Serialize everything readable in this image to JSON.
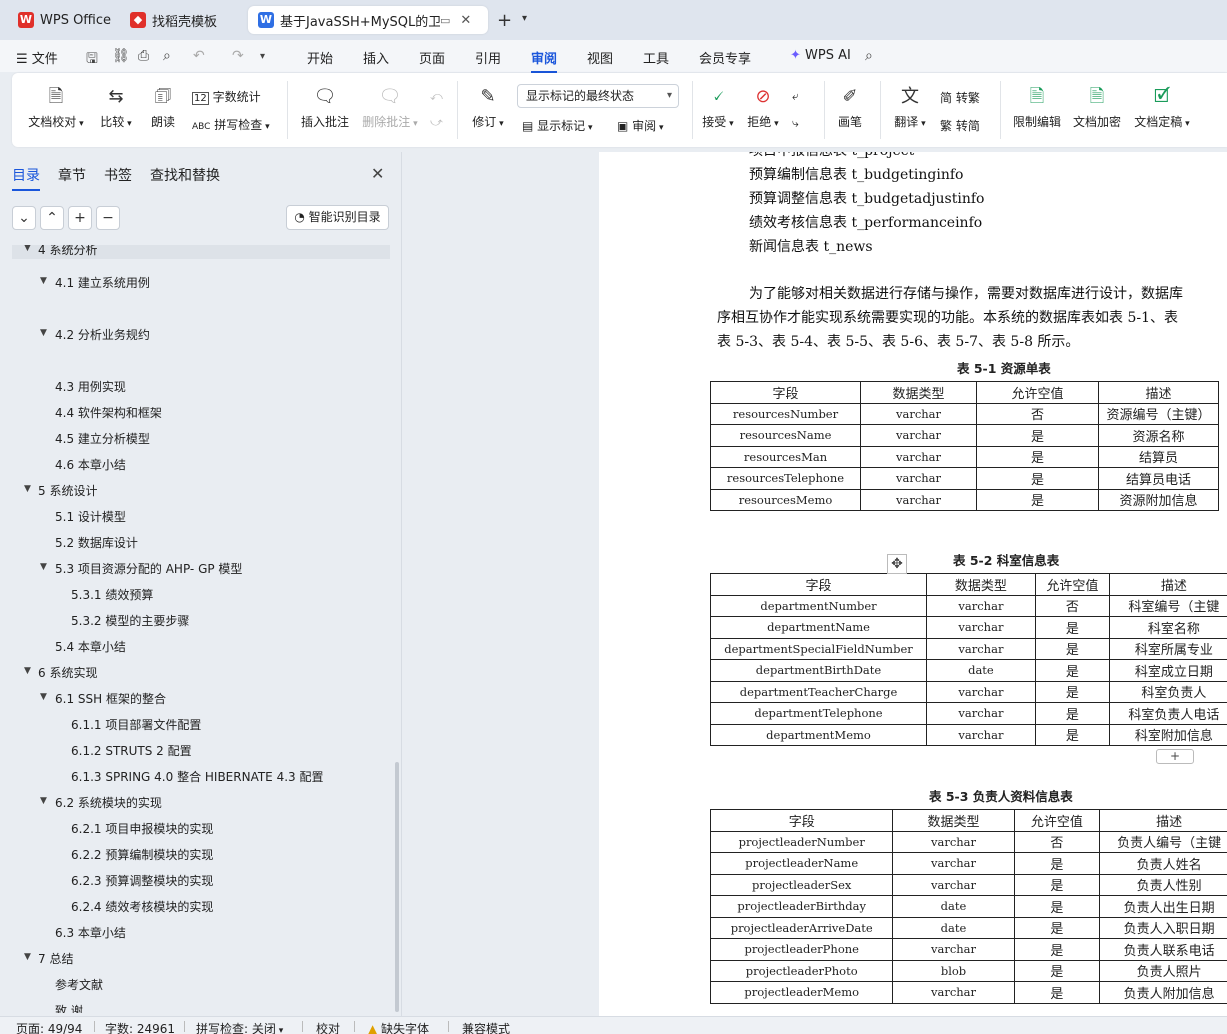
{
  "tabs": [
    {
      "label": "WPS Office",
      "logo": "wps-logo"
    },
    {
      "label": "找稻壳模板",
      "logo": "docer-logo"
    },
    {
      "label": "基于JavaSSH+MySQL的卫生",
      "logo": "writer-logo"
    }
  ],
  "menu": {
    "file": "文件",
    "items": [
      "开始",
      "插入",
      "页面",
      "引用",
      "审阅",
      "视图",
      "工具",
      "会员专享"
    ],
    "active": "审阅",
    "wps_ai": "WPS AI"
  },
  "ribbon": {
    "doc_proof": "文档校对",
    "compare": "比较",
    "read_aloud": "朗读",
    "word_count": "字数统计",
    "spell_check": "拼写检查",
    "insert_comment": "插入批注",
    "delete_comment": "删除批注",
    "track": "修订",
    "markup_state": "显示标记的最终状态",
    "show_markup": "显示标记",
    "review": "审阅",
    "accept": "接受",
    "reject": "拒绝",
    "ink": "画笔",
    "translate": "翻译",
    "simp_to_trad": "简 转繁",
    "trad_to_simp": "繁 转简",
    "restrict": "限制编辑",
    "encrypt": "文档加密",
    "finalize": "文档定稿"
  },
  "nav": {
    "tabs": [
      "目录",
      "章节",
      "书签",
      "查找和替换"
    ],
    "smart_toc": "智能识别目录",
    "toc": [
      {
        "label": "4  系统分析",
        "level": 1,
        "arrow": true
      },
      {
        "label": "4.1  建立系统用例",
        "level": 2,
        "arrow": true
      },
      {
        "label": "4.2  分析业务规约",
        "level": 2,
        "arrow": true
      },
      {
        "label": "4.3  用例实现",
        "level": 2,
        "arrow": false
      },
      {
        "label": "4.4  软件架构和框架",
        "level": 2,
        "arrow": false
      },
      {
        "label": "4.5  建立分析模型",
        "level": 2,
        "arrow": false
      },
      {
        "label": "4.6  本章小结",
        "level": 2,
        "arrow": false
      },
      {
        "label": "5  系统设计",
        "level": 1,
        "arrow": true
      },
      {
        "label": "5.1  设计模型",
        "level": 2,
        "arrow": false
      },
      {
        "label": "5.2  数据库设计",
        "level": 2,
        "arrow": false
      },
      {
        "label": "5.3  项目资源分配的 AHP- GP  模型",
        "level": 2,
        "arrow": true
      },
      {
        "label": "5.3.1 绩效预算",
        "level": 3,
        "arrow": false
      },
      {
        "label": "5.3.2 模型的主要步骤",
        "level": 3,
        "arrow": false
      },
      {
        "label": "5.4  本章小结",
        "level": 2,
        "arrow": false
      },
      {
        "label": "6  系统实现",
        "level": 1,
        "arrow": true
      },
      {
        "label": "6.1    SSH 框架的整合",
        "level": 2,
        "arrow": true
      },
      {
        "label": "6.1.1 项目部署文件配置",
        "level": 3,
        "arrow": false
      },
      {
        "label": "6.1.2 STRUTS 2 配置",
        "level": 3,
        "arrow": false
      },
      {
        "label": "6.1.3 SPRING 4.0 整合 HIBERNATE 4.3 配置",
        "level": 3,
        "arrow": false
      },
      {
        "label": "6.2    系统模块的实现",
        "level": 2,
        "arrow": true
      },
      {
        "label": "6.2.1 项目申报模块的实现",
        "level": 3,
        "arrow": false
      },
      {
        "label": "6.2.2 预算编制模块的实现",
        "level": 3,
        "arrow": false
      },
      {
        "label": "6.2.3 预算调整模块的实现",
        "level": 3,
        "arrow": false
      },
      {
        "label": "6.2.4 绩效考核模块的实现",
        "level": 3,
        "arrow": false
      },
      {
        "label": "6.3  本章小结",
        "level": 2,
        "arrow": false
      },
      {
        "label": "7  总结",
        "level": 1,
        "arrow": true
      },
      {
        "label": "参考文献",
        "level": 2,
        "arrow": false
      },
      {
        "label": "致  谢",
        "level": 2,
        "arrow": false
      }
    ]
  },
  "doc": {
    "list_lines": [
      "项目申报信息表 t_project",
      "预算编制信息表 t_budgetinginfo",
      "预算调整信息表 t_budgetadjustinfo",
      "绩效考核信息表 t_performanceinfo",
      "新闻信息表 t_news"
    ],
    "para": [
      "为了能够对相关数据进行存储与操作，需要对数据库进行设计，数据库",
      "序相互协作才能实现系统需要实现的功能。本系统的数据库表如表 5-1、表",
      "表 5-3、表 5-4、表 5-5、表 5-6、表 5-7、表 5-8 所示。"
    ],
    "tables": [
      {
        "caption": "表 5-1  资源单表",
        "headers": [
          "字段",
          "数据类型",
          "允许空值",
          "描述"
        ],
        "rows": [
          [
            "resourcesNumber",
            "varchar",
            "否",
            "资源编号（主键）"
          ],
          [
            "resourcesName",
            "varchar",
            "是",
            "资源名称"
          ],
          [
            "resourcesMan",
            "varchar",
            "是",
            "结算员"
          ],
          [
            "resourcesTelephone",
            "varchar",
            "是",
            "结算员电话"
          ],
          [
            "resourcesMemo",
            "varchar",
            "是",
            "资源附加信息"
          ]
        ]
      },
      {
        "caption": "表 5-2 科室信息表",
        "headers": [
          "字段",
          "数据类型",
          "允许空值",
          "描述"
        ],
        "rows": [
          [
            "departmentNumber",
            "varchar",
            "否",
            "科室编号（主键"
          ],
          [
            "departmentName",
            "varchar",
            "是",
            "科室名称"
          ],
          [
            "departmentSpecialFieldNumber",
            "varchar",
            "是",
            "科室所属专业"
          ],
          [
            "departmentBirthDate",
            "date",
            "是",
            "科室成立日期"
          ],
          [
            "departmentTeacherCharge",
            "varchar",
            "是",
            "科室负责人"
          ],
          [
            "departmentTelephone",
            "varchar",
            "是",
            "科室负责人电话"
          ],
          [
            "departmentMemo",
            "varchar",
            "是",
            "科室附加信息"
          ]
        ]
      },
      {
        "caption": "表 5-3  负责人资料信息表",
        "headers": [
          "字段",
          "数据类型",
          "允许空值",
          "描述"
        ],
        "rows": [
          [
            "projectleaderNumber",
            "varchar",
            "否",
            "负责人编号（主键"
          ],
          [
            "projectleaderName",
            "varchar",
            "是",
            "负责人姓名"
          ],
          [
            "projectleaderSex",
            "varchar",
            "是",
            "负责人性别"
          ],
          [
            "projectleaderBirthday",
            "date",
            "是",
            "负责人出生日期"
          ],
          [
            "projectleaderArriveDate",
            "date",
            "是",
            "负责人入职日期"
          ],
          [
            "projectleaderPhone",
            "varchar",
            "是",
            "负责人联系电话"
          ],
          [
            "projectleaderPhoto",
            "blob",
            "是",
            "负责人照片"
          ],
          [
            "projectleaderMemo",
            "varchar",
            "是",
            "负责人附加信息"
          ]
        ]
      }
    ]
  },
  "status": {
    "page": "页面: 49/94",
    "words": "字数: 24961",
    "spell": "拼写检查: 关闭",
    "proof": "校对",
    "missing_font": "缺失字体",
    "compat": "兼容模式"
  },
  "colors": {
    "accent": "#1a56db",
    "wps_red": "#e0302a"
  }
}
